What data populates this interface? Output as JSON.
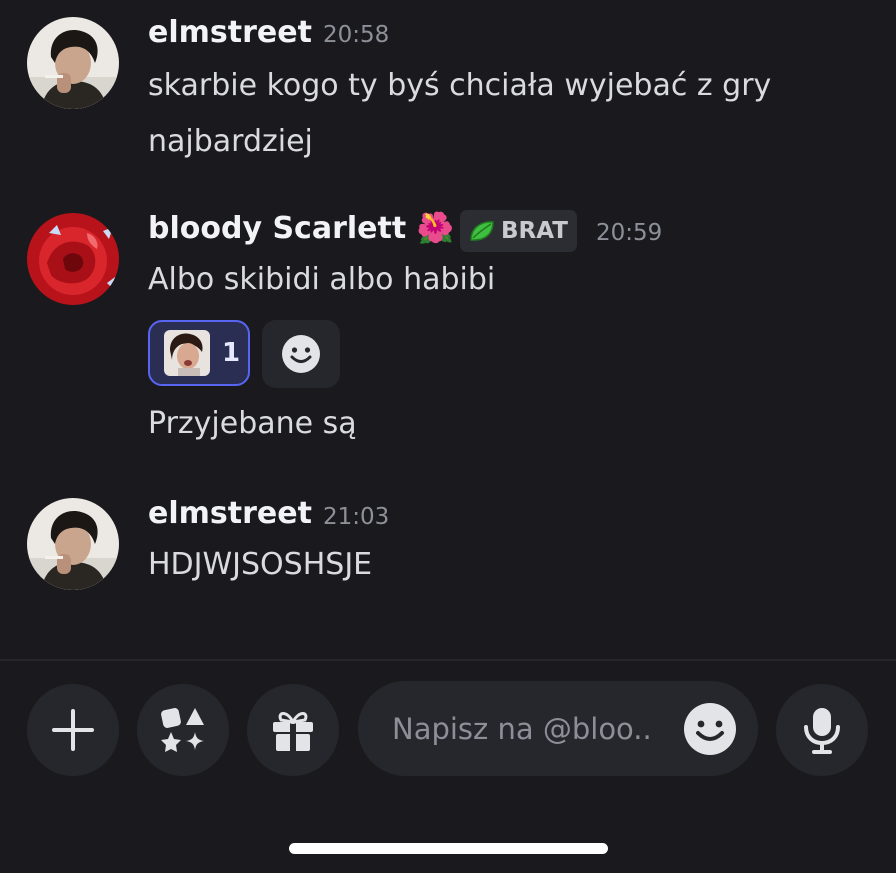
{
  "messages": [
    {
      "username": "elmstreet",
      "time": "20:58",
      "lines": [
        "skarbie kogo ty byś chciała wyjebać z gry",
        "najbardziej"
      ]
    },
    {
      "username": "bloody Scarlett",
      "username_emoji": "🌺",
      "badge": {
        "icon": "leaf-icon",
        "label": "BRAT",
        "color": "#3fbf3f"
      },
      "time": "20:59",
      "lines": [
        "Albo skibidi albo habibi"
      ],
      "reaction": {
        "count": "1",
        "accent": "#5865f2"
      },
      "followup": "Przyjebane są"
    },
    {
      "username": "elmstreet",
      "time": "21:03",
      "lines": [
        "HDJWJSOSHSJE"
      ]
    }
  ],
  "composer": {
    "placeholder": "Napisz na @bloo..",
    "value": ""
  },
  "toolbar": {
    "icons": [
      "plus-icon",
      "apps-icon",
      "gift-icon",
      "emoji-icon",
      "microphone-icon"
    ]
  },
  "colors": {
    "background": "#1a1a1e",
    "accent": "#5865f2",
    "timestamp": "#8e9099"
  }
}
